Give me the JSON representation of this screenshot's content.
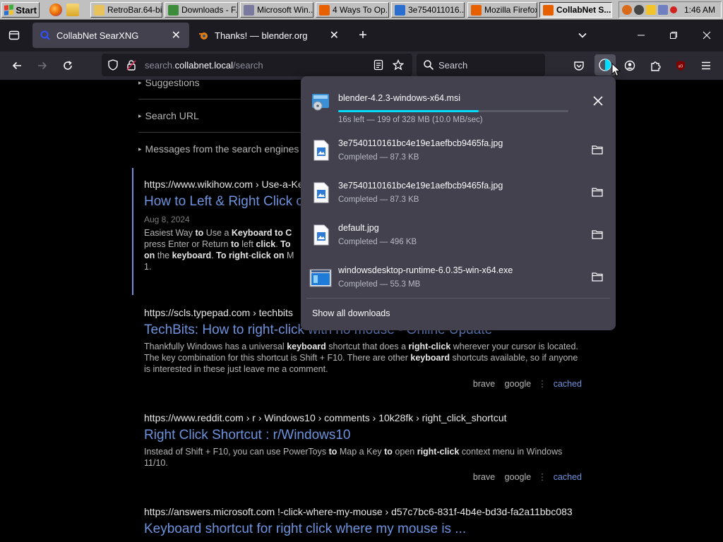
{
  "taskbar": {
    "start_label": "Start",
    "buttons": [
      {
        "label": "RetroBar.64-bi...",
        "color": "#e8c25a"
      },
      {
        "label": "Downloads - F...",
        "color": "#3c8c3c"
      },
      {
        "label": "Microsoft Win...",
        "color": "#7a7aa0"
      },
      {
        "label": "4 Ways To Op...",
        "color": "#e66000"
      },
      {
        "label": "3e754011016...",
        "color": "#2a6fcf"
      },
      {
        "label": "Mozilla Firefox",
        "color": "#e66000"
      },
      {
        "label": "CollabNet S...",
        "color": "#e66000"
      }
    ],
    "clock": "1:46 AM"
  },
  "browser": {
    "tabs": [
      {
        "label": "CollabNet SearXNG",
        "active": true
      },
      {
        "label": "Thanks! — blender.org",
        "active": false
      }
    ],
    "url": {
      "prefix": "search.",
      "domain": "collabnet.local",
      "path": "/search"
    },
    "search_placeholder": "Search"
  },
  "page": {
    "sections": [
      "Suggestions",
      "Search URL",
      "Messages from the search engines"
    ],
    "results": [
      {
        "url": "https://www.wikihow.com  › Use-a-Ke",
        "title": "How to Left & Right Click c",
        "date": "Aug 8, 2024",
        "snippet_html": "Easiest Way <b>to</b> Use a <b>Keyboard to C</b><br>press Enter or Return <b>to</b> left <b>click</b>. <b>To</b><br><b>on</b> the <b>keyboard</b>. <b>To right</b>-<b>click on</b> M<br>1."
      },
      {
        "url": "https://scls.typepad.com  › techbits",
        "title": "TechBits: How to right-click with no mouse - Online Update",
        "snippet_html": "Thankfully Windows has a universal <b>keyboard</b> shortcut that does a <b>right-click</b> wherever your cursor is located. The key combination for this shortcut is Shift + F10. There are other <b>keyboard</b> shortcuts available, so if anyone is interested in these just leave me a comment.",
        "engines": [
          "brave",
          "google"
        ],
        "cached": "cached"
      },
      {
        "url": "https://www.reddit.com  › r › Windows10 › comments › 10k28fk › right_click_shortcut",
        "title": "Right Click Shortcut : r/Windows10",
        "snippet_html": "Instead of Shift + F10, you can use PowerToys <b>to</b> Map a Key <b>to</b> open <b>right-click</b> context menu in Windows 11/10.",
        "engines": [
          "brave",
          "google"
        ],
        "cached": "cached"
      },
      {
        "url": "https://answers.microsoft.com  !-click-where-my-mouse › d57c7bc6-831f-4b4e-bd3d-fa2a11bbc083",
        "title": "Keyboard shortcut for right click where my mouse is ..."
      }
    ]
  },
  "downloads": {
    "items": [
      {
        "name": "blender-4.2.3-windows-x64.msi",
        "status": "16s left — 199 of 328 MB (10.0 MB/sec)",
        "progress": 0.61,
        "icon": "msi-icon",
        "action": "cancel"
      },
      {
        "name": "3e7540110161bc4e19e1aefbcb9465fa.jpg",
        "status": "Completed — 87.3 KB",
        "icon": "image-file-icon",
        "action": "folder"
      },
      {
        "name": "3e7540110161bc4e19e1aefbcb9465fa.jpg",
        "status": "Completed — 87.3 KB",
        "icon": "image-file-icon",
        "action": "folder"
      },
      {
        "name": "default.jpg",
        "status": "Completed — 496 KB",
        "icon": "image-file-icon",
        "action": "folder"
      },
      {
        "name": "windowsdesktop-runtime-6.0.35-win-x64.exe",
        "status": "Completed — 55.3 MB",
        "icon": "exe-icon",
        "action": "folder"
      }
    ],
    "show_all": "Show all downloads"
  }
}
